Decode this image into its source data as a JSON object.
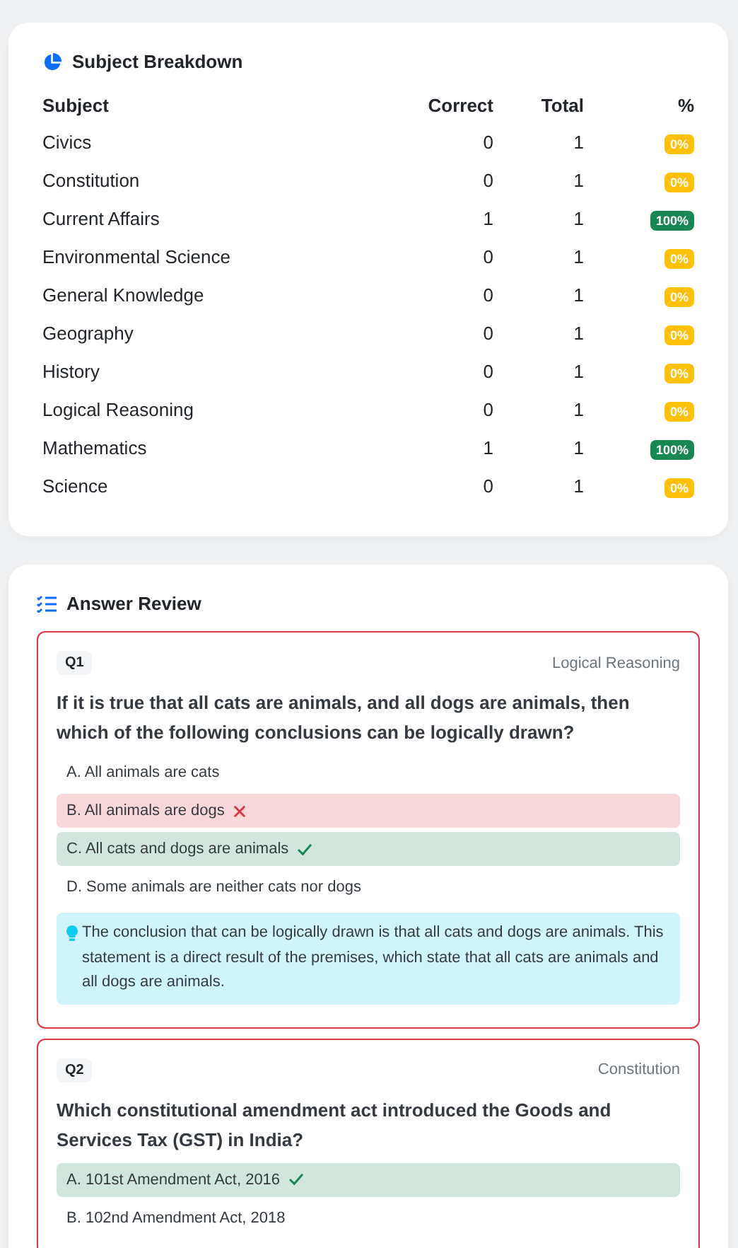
{
  "breakdown": {
    "title": "Subject Breakdown",
    "columns": [
      "Subject",
      "Correct",
      "Total",
      "%"
    ],
    "rows": [
      {
        "subject": "Civics",
        "correct": "0",
        "total": "1",
        "percent": "0%",
        "color": "#ffc107"
      },
      {
        "subject": "Constitution",
        "correct": "0",
        "total": "1",
        "percent": "0%",
        "color": "#ffc107"
      },
      {
        "subject": "Current Affairs",
        "correct": "1",
        "total": "1",
        "percent": "100%",
        "color": "#198754"
      },
      {
        "subject": "Environmental Science",
        "correct": "0",
        "total": "1",
        "percent": "0%",
        "color": "#ffc107"
      },
      {
        "subject": "General Knowledge",
        "correct": "0",
        "total": "1",
        "percent": "0%",
        "color": "#ffc107"
      },
      {
        "subject": "Geography",
        "correct": "0",
        "total": "1",
        "percent": "0%",
        "color": "#ffc107"
      },
      {
        "subject": "History",
        "correct": "0",
        "total": "1",
        "percent": "0%",
        "color": "#ffc107"
      },
      {
        "subject": "Logical Reasoning",
        "correct": "0",
        "total": "1",
        "percent": "0%",
        "color": "#ffc107"
      },
      {
        "subject": "Mathematics",
        "correct": "1",
        "total": "1",
        "percent": "100%",
        "color": "#198754"
      },
      {
        "subject": "Science",
        "correct": "0",
        "total": "1",
        "percent": "0%",
        "color": "#ffc107"
      }
    ]
  },
  "review": {
    "title": "Answer Review",
    "questions": [
      {
        "number": "Q1",
        "subject": "Logical Reasoning",
        "text": "If it is true that all cats are animals, and all dogs are animals, then which of the following conclusions can be logically drawn?",
        "options": [
          {
            "text": "A. All animals are cats",
            "chosen": false,
            "correct": false
          },
          {
            "text": "B. All animals are dogs",
            "chosen": true,
            "correct": false
          },
          {
            "text": "C. All cats and dogs are animals",
            "chosen": false,
            "correct": true
          },
          {
            "text": "D. Some animals are neither cats nor dogs",
            "chosen": false,
            "correct": false
          }
        ],
        "explanation": "The conclusion that can be logically drawn is that all cats and dogs are animals. This statement is a direct result of the premises, which state that all cats are animals and all dogs are animals."
      },
      {
        "number": "Q2",
        "subject": "Constitution",
        "text": "Which constitutional amendment act introduced the Goods and Services Tax (GST) in India?",
        "options": [
          {
            "text": "A. 101st Amendment Act, 2016",
            "chosen": false,
            "correct": true
          },
          {
            "text": "B. 102nd Amendment Act, 2018",
            "chosen": false,
            "correct": false
          }
        ]
      }
    ]
  }
}
